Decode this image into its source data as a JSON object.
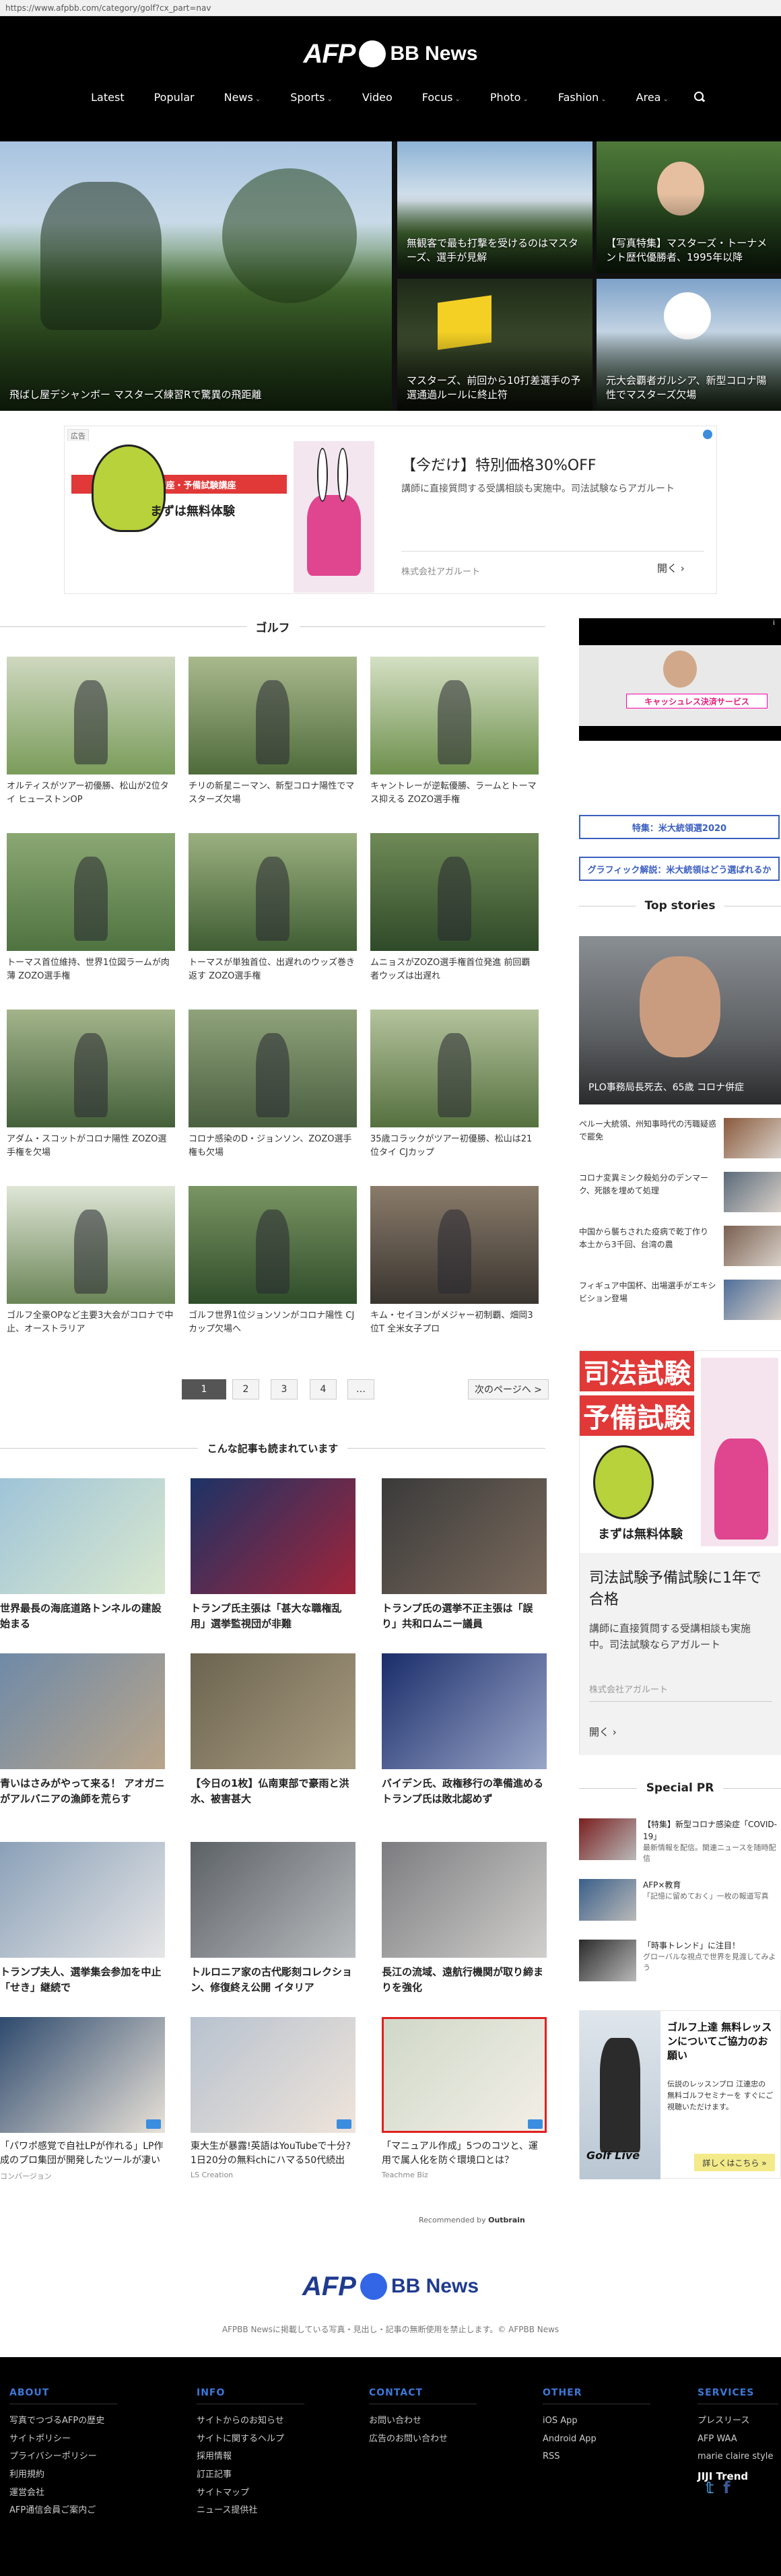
{
  "browser": {
    "url": "https://www.afpbb.com/category/golf?cx_part=nav"
  },
  "brand": {
    "afp": "AFP",
    "bb": "BB News"
  },
  "nav": {
    "items": [
      {
        "label": "Latest",
        "dropdown": false
      },
      {
        "label": "Popular",
        "dropdown": false
      },
      {
        "label": "News",
        "dropdown": true
      },
      {
        "label": "Sports",
        "dropdown": true
      },
      {
        "label": "Video",
        "dropdown": false
      },
      {
        "label": "Focus",
        "dropdown": true
      },
      {
        "label": "Photo",
        "dropdown": true
      },
      {
        "label": "Fashion",
        "dropdown": true
      },
      {
        "label": "Area",
        "dropdown": true
      }
    ],
    "search_icon": "search-icon"
  },
  "hero": {
    "main": "飛ばし屋デシャンボー マスターズ練習Rで驚異の飛距離",
    "t1": "無観客で最も打撃を受けるのはマスターズ、選手が見解",
    "t2": "【写真特集】マスターズ・トーナメント歴代優勝者、1995年以降",
    "t3": "マスターズ、前回から10打差選手の予選通過ルールに終止符",
    "t4": "元大会覇者ガルシア、新型コロナ陽性でマスターズ欠場"
  },
  "ad_banner": {
    "label": "広告",
    "left_title": "司法試験講座・予備試験講座",
    "left_sub": "まずは無料体験",
    "headline": "【今だけ】特別価格30%OFF",
    "body": "講師に直接質問する受講相談も実施中。司法試験ならアガルート",
    "advertiser": "株式会社アガルート",
    "cta": "開く"
  },
  "golf": {
    "title": "ゴルフ",
    "cards": [
      {
        "title": "オルティスがツアー初優勝、松山が2位タイ ヒューストンOP",
        "c1": "#7a9c5a",
        "c2": "#cfd8c0"
      },
      {
        "title": "チリの新星ニーマン、新型コロナ陽性でマスターズ欠場",
        "c1": "#4f6b3a",
        "c2": "#a9b98e"
      },
      {
        "title": "キャントレーが逆転優勝、ラームとトーマス抑える ZOZO選手権",
        "c1": "#6d8f4c",
        "c2": "#d5e0c4"
      },
      {
        "title": "トーマス首位維持、世界1位図ラームが肉薄 ZOZO選手権",
        "c1": "#4f7340",
        "c2": "#8ba873"
      },
      {
        "title": "トーマスが単独首位、出遅れのウッズ巻き返す ZOZO選手権",
        "c1": "#3f5d33",
        "c2": "#9bb07f"
      },
      {
        "title": "ムニョスがZOZO選手権首位発進 前回覇者ウッズは出遅れ",
        "c1": "#2f4a28",
        "c2": "#6f8a56"
      },
      {
        "title": "アダム・スコットがコロナ陽性 ZOZO選手権を欠場",
        "c1": "#44603a",
        "c2": "#a3b48a"
      },
      {
        "title": "コロナ感染のD・ジョンソン、ZOZO選手権も欠場",
        "c1": "#4a5f40",
        "c2": "#8fa27a"
      },
      {
        "title": "35歳コラックがツアー初優勝、松山は21位タイ CJカップ",
        "c1": "#55703f",
        "c2": "#b4c39c"
      },
      {
        "title": "ゴルフ全豪OPなど主要3大会がコロナで中止、オーストラリア",
        "c1": "#6a8456",
        "c2": "#dfe6d6"
      },
      {
        "title": "ゴルフ世界1位ジョンソンがコロナ陽性 CJカップ欠場へ",
        "c1": "#2f4d2a",
        "c2": "#7a9563"
      },
      {
        "title": "キム・セイヨンがメジャー初制覇、畑岡3位T 全米女子プロ",
        "c1": "#3a3530",
        "c2": "#8a7b6a"
      }
    ]
  },
  "pager": {
    "pages": [
      "1",
      "2",
      "3",
      "4",
      "…"
    ],
    "next": "次のページへ >"
  },
  "related": {
    "title": "こんな記事も読まれています",
    "cards": [
      {
        "title": "世界最長の海底道路トンネルの建設始まる",
        "src": "",
        "c1": "#9fc4d8",
        "c2": "#d9e8cf",
        "pr": false
      },
      {
        "title": "トランプ氏主張は「甚大な職権乱用」選挙監視団が非難",
        "src": "",
        "c1": "#1c3366",
        "c2": "#a0243a",
        "pr": false
      },
      {
        "title": "トランプ氏の選挙不正主張は「誤り」共和ロムニー議員",
        "src": "",
        "c1": "#3a3a3a",
        "c2": "#7a6a5c",
        "pr": false
      },
      {
        "title": "青いはさみがやって来る！ アオガニがアルバニアの漁師を荒らす",
        "src": "",
        "c1": "#6f8aa8",
        "c2": "#b9a58a",
        "pr": false
      },
      {
        "title": "【今日の1枚】仏南東部で豪雨と洪水、被害甚大",
        "src": "",
        "c1": "#6c6450",
        "c2": "#a89c80",
        "pr": false
      },
      {
        "title": "バイデン氏、政権移行の準備進める トランプ氏は敗北認めず",
        "src": "",
        "c1": "#1a2d6a",
        "c2": "#9aa6c8",
        "pr": false
      },
      {
        "title": "トランプ夫人、選挙集会参加を中止「せき」継続で",
        "src": "",
        "c1": "#8aa0b8",
        "c2": "#e6e6e6",
        "pr": false
      },
      {
        "title": "トルロニア家の古代彫刻コレクション、修復終え公開 イタリア",
        "src": "",
        "c1": "#5c6166",
        "c2": "#b9bcbf",
        "pr": false
      },
      {
        "title": "長江の流域、遠航行機関が取り締まりを強化",
        "src": "",
        "c1": "#7c7c80",
        "c2": "#d0cfcc",
        "pr": false
      },
      {
        "title": "「パワポ感覚で自社LPが作れる」LP作成のプロ集団が開発したツールが凄い",
        "src": "コンバージョン",
        "c1": "#2e4a6e",
        "c2": "#e9e2d8",
        "pr": true
      },
      {
        "title": "東大生が暴露!英語はYouTubeで十分?1日20分の無料chにハマる50代続出",
        "src": "LS Creation",
        "c1": "#b7c2cf",
        "c2": "#efe4da",
        "pr": true
      },
      {
        "title": "「マニュアル作成」5つのコツと、運用で属人化を防ぐ環境口とは？",
        "src": "Teachme Biz",
        "c1": "#cfd8c8",
        "c2": "#f3efe7",
        "pr": true
      }
    ],
    "recommended": "Recommended by",
    "outbrain": "Outbrain"
  },
  "sidebar": {
    "video_banner": "キャッシュレス決済サービス",
    "links": [
      "特集：米大統領選2020",
      "グラフィック解説：米大統領はどう選ばれるか"
    ],
    "top_stories_title": "Top stories",
    "top_main": "PLO事務局長死去、65歳 コロナ併症",
    "top_items": [
      "ペルー大統領、州知事時代の汚職疑惑で罷免",
      "コロナ変異ミンク殺処分のデンマーク、死骸を埋めて処理",
      "中国から襲ちされた疫病で乾丁作り 本土から3千回、台湾の農",
      "フィギュア中国杯、出場選手がエキシビション登場"
    ],
    "ad": {
      "line1": "司法試験",
      "line2": "予備試験",
      "free": "まずは無料体験",
      "headline": "司法試験予備試験に1年で合格",
      "body": "講師に直接質問する受講相談も実施中。司法試験ならアガルート",
      "advertiser": "株式会社アガルート",
      "cta": "開く"
    },
    "special_pr_title": "Special PR",
    "pr_items": [
      {
        "t": "【特集】新型コロナ感染症「COVID-19」",
        "d": "最新情報を配信。関連ニュースを随時配信"
      },
      {
        "t": "AFP×教育",
        "d": "「記憶に留めておく」一枚の報道写真"
      },
      {
        "t": "「時事トレンド」に注目！",
        "d": "グローバルな視点で世界を見渡してみよう"
      }
    ],
    "ad2": {
      "headline": "ゴルフ上達 無料レッスンについてご協力のお願い",
      "body": "伝説のレッスンプロ 江連忠の 無料ゴルフセミナーを すぐにご視聴いただけます。",
      "brand": "Golf Live",
      "cta": "詳しくはこちら »"
    }
  },
  "bottom_logo": {
    "afp": "AFP",
    "bb": "BB News",
    "copyright": "AFPBB Newsに掲載している写真・見出し・記事の無断使用を禁止します。© AFPBB News"
  },
  "footer": {
    "about": {
      "title": "ABOUT",
      "links": [
        "写真でつづるAFPの歴史",
        "サイトポリシー",
        "プライバシーポリシー",
        "利用規約",
        "運営会社",
        "AFP通信会員ご案内ご"
      ]
    },
    "info": {
      "title": "INFO",
      "links": [
        "サイトからのお知らせ",
        "サイトに関するヘルプ",
        "採用情報",
        "訂正記事",
        "サイトマップ",
        "ニュース提供社"
      ]
    },
    "contact": {
      "title": "CONTACT",
      "links": [
        "お問い合わせ",
        "広告のお問い合わせ"
      ]
    },
    "other": {
      "title": "OTHER",
      "links": [
        "iOS App",
        "Android App",
        "RSS"
      ]
    },
    "services": {
      "title": "SERVICES",
      "links": [
        "プレスリース",
        "AFP WAA",
        "marie claire style"
      ],
      "jiji": "JIJI Trend"
    },
    "social": [
      "twitter-icon",
      "facebook-icon"
    ]
  }
}
